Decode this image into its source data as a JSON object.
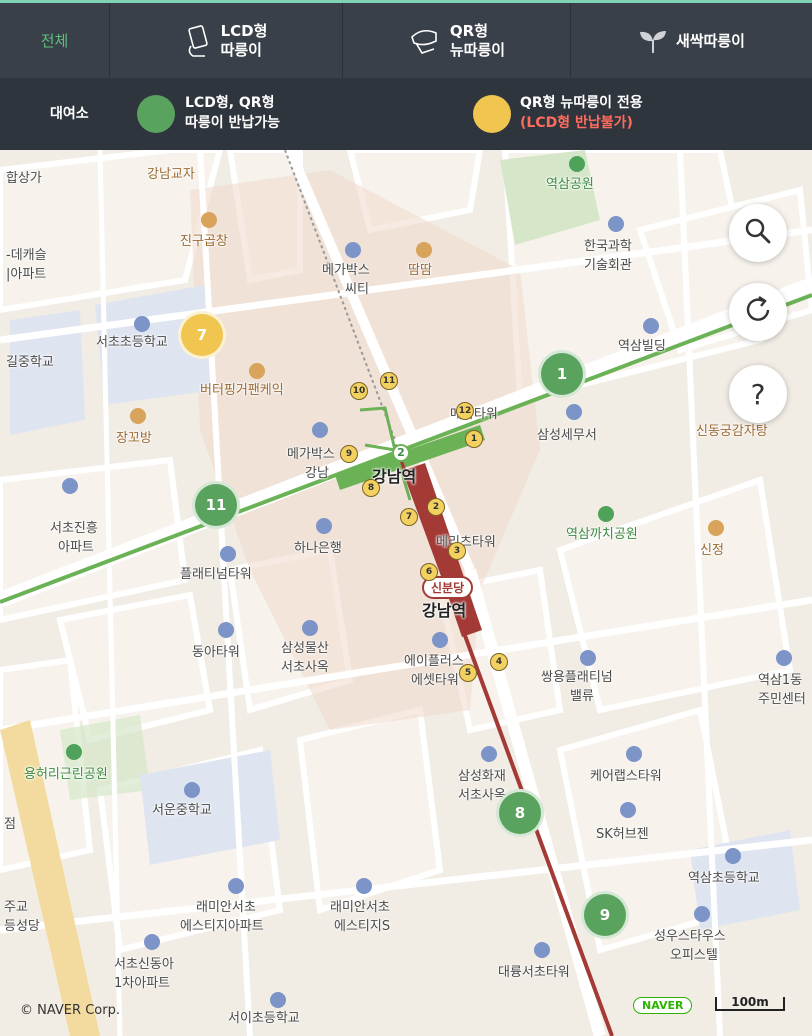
{
  "tabs": [
    {
      "label": "전체",
      "icon": "all"
    },
    {
      "label": "LCD형\n따릉이",
      "icon": "lcd-device-icon"
    },
    {
      "label": "QR형\n뉴따릉이",
      "icon": "qr-device-icon"
    },
    {
      "label": "새싹따릉이",
      "icon": "sprout-icon"
    }
  ],
  "legend": {
    "title": "대여소",
    "green_line1": "LCD형, QR형",
    "green_line2": "따릉이 반납가능",
    "yellow_line1": "QR형 뉴따릉이 전용",
    "yellow_line2": "(LCD형 반납불가)",
    "green_color": "#5aa35e",
    "yellow_color": "#f0c650"
  },
  "map": {
    "stations": {
      "gangnam_line2": "강남역",
      "gangnam_sinbundang": "강남역",
      "sinbundang_tag": "신분당",
      "line2_num": "2"
    },
    "pois": [
      "합상가",
      "강남교자",
      "역삼공원",
      "진구곱창",
      "한국과학",
      "기술회관",
      "-데캐슬",
      "|아파트",
      "메가박스",
      "씨티",
      "땀땀",
      "서초초등학교",
      "역삼빌딩",
      "길중학교",
      "버터핑거팬케익",
      "메가타워",
      "삼성세무서",
      "신동궁감자탕",
      "장꼬방",
      "메가박스",
      "강남",
      "서초진흥",
      "아파트",
      "하나은행",
      "메리츠타워",
      "역삼까치공원",
      "신정",
      "플래티넘타워",
      "동아타워",
      "삼성물산",
      "서초사옥",
      "에이플러스",
      "에셋타워",
      "쌍용플래티넘",
      "밸류",
      "역삼1동",
      "주민센터",
      "용허리근린공원",
      "삼성화재",
      "서초사옥",
      "케어랩스타워",
      "서운중학교",
      "SK허브젠",
      "역삼초등학교",
      "래미안서초",
      "에스티지아파트",
      "래미안서초",
      "에스티지S",
      "성우스타우스",
      "오피스텔",
      "서초신동아",
      "1차아파트",
      "대륭서초타워",
      "서이초등학교",
      "점",
      "주교",
      "등성당"
    ],
    "clusters_green": [
      "1",
      "11",
      "8",
      "9"
    ],
    "clusters_yellow": [
      "7"
    ],
    "small_markers": [
      "10",
      "11",
      "12",
      "1",
      "2",
      "9",
      "8",
      "7",
      "2",
      "3",
      "6",
      "4",
      "5"
    ],
    "copyright": "© NAVER Corp.",
    "naver_badge": "NAVER",
    "scale_label": "100m"
  },
  "controls": {
    "search": "search",
    "refresh": "refresh",
    "help": "?"
  }
}
